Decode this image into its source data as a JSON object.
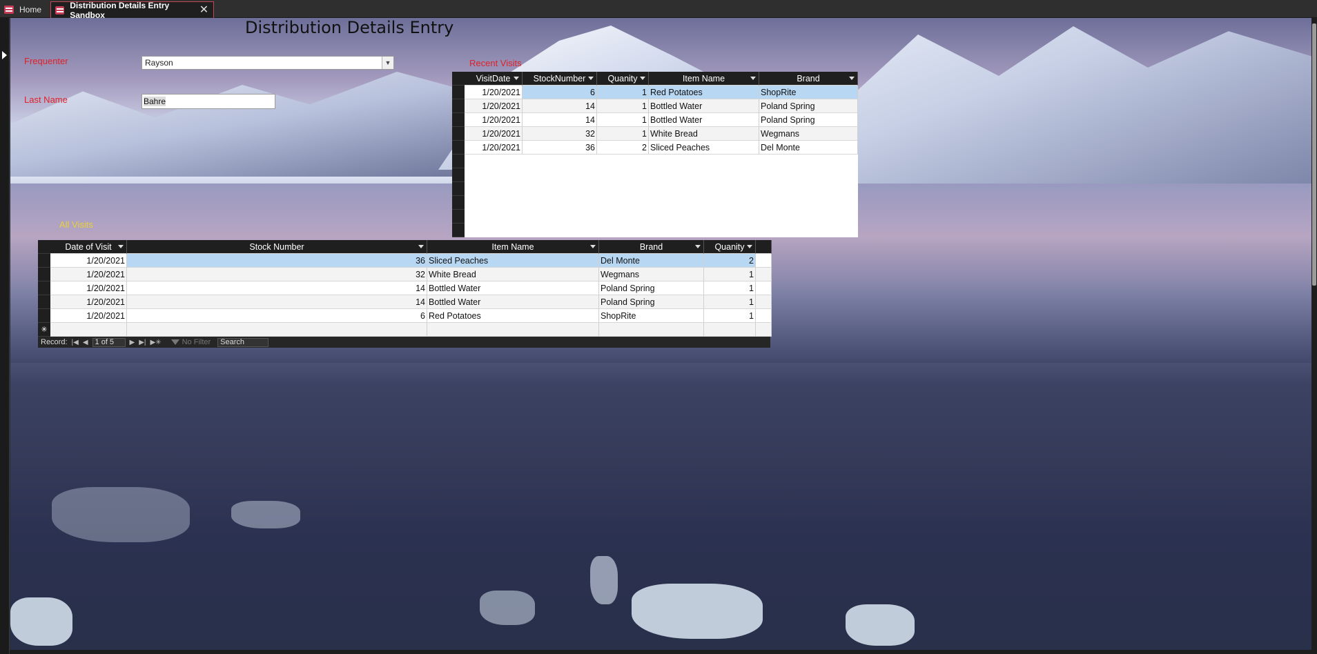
{
  "tabs": {
    "home": "Home",
    "active": "Distribution Details Entry Sandbox",
    "close_glyph": "✕"
  },
  "form": {
    "title": "Distribution Details Entry",
    "frequenter_label": "Frequenter",
    "frequenter_value": "Rayson",
    "last_name_label": "Last Name",
    "last_name_value": "Bahre",
    "recent_visits_label": "Recent Visits",
    "all_visits_label": "All Visits"
  },
  "recent_visits": {
    "columns": [
      "VisitDate",
      "StockNumber",
      "Quanity",
      "Item Name",
      "Brand"
    ],
    "rows": [
      [
        "1/20/2021",
        "6",
        "1",
        "Red Potatoes",
        "ShopRite"
      ],
      [
        "1/20/2021",
        "14",
        "1",
        "Bottled Water",
        "Poland Spring"
      ],
      [
        "1/20/2021",
        "14",
        "1",
        "Bottled Water",
        "Poland Spring"
      ],
      [
        "1/20/2021",
        "32",
        "1",
        "White Bread",
        "Wegmans"
      ],
      [
        "1/20/2021",
        "36",
        "2",
        "Sliced Peaches",
        "Del Monte"
      ]
    ]
  },
  "all_visits": {
    "columns": [
      "Date of Visit",
      "Stock Number",
      "Item Name",
      "Brand",
      "Quanity"
    ],
    "rows": [
      [
        "1/20/2021",
        "36",
        "Sliced Peaches",
        "Del Monte",
        "2"
      ],
      [
        "1/20/2021",
        "32",
        "White Bread",
        "Wegmans",
        "1"
      ],
      [
        "1/20/2021",
        "14",
        "Bottled Water",
        "Poland Spring",
        "1"
      ],
      [
        "1/20/2021",
        "14",
        "Bottled Water",
        "Poland Spring",
        "1"
      ],
      [
        "1/20/2021",
        "6",
        "Red Potatoes",
        "ShopRite",
        "1"
      ]
    ],
    "new_row_glyph": "✳"
  },
  "navigation": {
    "record_label": "Record:",
    "position": "1 of 5",
    "first": "|◀",
    "prev": "◀",
    "next": "▶",
    "last": "▶|",
    "new": "▶✳",
    "filter": "No Filter",
    "search": "Search"
  },
  "colors": {
    "label_red": "#e0202a",
    "label_yellow": "#e8d23a",
    "selected_row": "#b7d7f3",
    "tab_accent": "#c44a57"
  }
}
